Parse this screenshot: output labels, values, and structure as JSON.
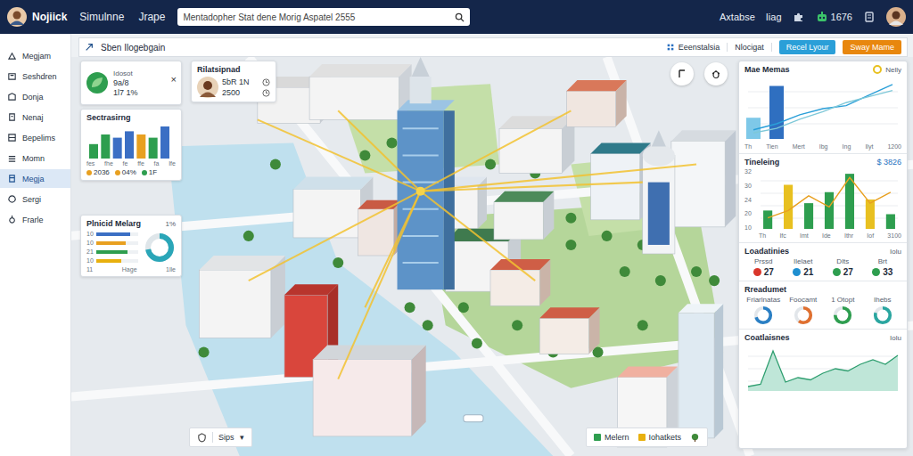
{
  "app": {
    "name": "Nojiick"
  },
  "nav": [
    {
      "label": "Simulnne",
      "selected": false
    },
    {
      "label": "Jrape",
      "selected": false
    }
  ],
  "search": {
    "value": "Mentadopher Stat dene Morig Aspatel 2555"
  },
  "header_links": [
    "Axtabse",
    "Iiag"
  ],
  "header_count": "1676",
  "sidebar": {
    "items": [
      {
        "label": "Megjam",
        "selected": false
      },
      {
        "label": "Seshdren",
        "selected": false
      },
      {
        "label": "Donja",
        "selected": false
      },
      {
        "label": "Nenaj",
        "selected": false
      },
      {
        "label": "Bepelims",
        "selected": false
      },
      {
        "label": "Momn",
        "selected": false
      },
      {
        "label": "Megja",
        "selected": true
      },
      {
        "label": "Sergi",
        "selected": false
      },
      {
        "label": "Frarle",
        "selected": false
      }
    ]
  },
  "toolbar": {
    "title": "Sben Ilogebgain",
    "links": [
      "Eeenstalsia",
      "Nlocigat"
    ],
    "buttons": [
      {
        "label": "Recel Lyour",
        "color": "#2a9fd8"
      },
      {
        "label": "Sway Mame",
        "color": "#e8870e"
      }
    ]
  },
  "status_card": {
    "title": "Idosot",
    "lines": [
      "9a/8",
      "1l7 1%"
    ],
    "close": "×"
  },
  "person_card": {
    "title": "Rilatsipnad",
    "lines": [
      "5bR 1N",
      "2500"
    ]
  },
  "bars_card": {
    "title": "Sectrasirng",
    "values": [
      18,
      30,
      26,
      34,
      30,
      26,
      40
    ],
    "colors": [
      "#2e9e4f",
      "#2e9e4f",
      "#3b6fc4",
      "#3b6fc4",
      "#e8a020",
      "#2e9e4f",
      "#3b6fc4"
    ],
    "axis": [
      "fes",
      "fhe",
      "fe",
      "ffe",
      "fa",
      "Ife"
    ],
    "stats": [
      {
        "value": "2036",
        "color": "#e8a020"
      },
      {
        "value": "04%",
        "color": "#e8a020"
      },
      {
        "value": "1F",
        "color": "#2e9e4f"
      }
    ]
  },
  "mix_card": {
    "title": "Plnicid Melarg",
    "badge": "1%",
    "rows": [
      {
        "label": "10",
        "level": 0.8,
        "color": "#3b6fc4"
      },
      {
        "label": "10",
        "level": 0.7,
        "color": "#e8a020"
      },
      {
        "label": "21",
        "level": 0.75,
        "color": "#2e9e4f"
      },
      {
        "label": "10",
        "level": 0.6,
        "color": "#e8b00e"
      }
    ],
    "donut": {
      "level": 0.72,
      "color": "#2aa6b8"
    },
    "footer": [
      "11",
      "Hage",
      "1lle"
    ]
  },
  "map": {
    "control": {
      "label": "Sips",
      "caret": "▾"
    },
    "legend": [
      {
        "label": "Melern",
        "color": "#2e9e4f"
      },
      {
        "label": "Iohatkets",
        "color": "#e8b00e"
      }
    ]
  },
  "kpi_chart": {
    "title": "Mae Memas",
    "legend": {
      "label": "Nelly",
      "color": "#e8c020"
    },
    "bars": [
      28,
      70,
      0,
      0,
      0,
      0,
      0
    ],
    "bar_colors": [
      "#7ec8e8",
      "#2f6fc0",
      "#2f6fc0",
      "#2f6fc0",
      "#2f6fc0",
      "#2f6fc0",
      "#2f6fc0"
    ],
    "lines": [
      {
        "color": "#2a9fd8",
        "values": [
          12,
          20,
          32,
          40,
          44,
          58,
          72
        ]
      },
      {
        "color": "#7ec8d8",
        "values": [
          8,
          14,
          26,
          36,
          48,
          56,
          64
        ]
      }
    ],
    "x": [
      "Th",
      "Tien",
      "Mert",
      "Ibg",
      "Ing",
      "Ilyt",
      "1200"
    ]
  },
  "trend_chart": {
    "title": "Tineleing",
    "value": "$ 3826",
    "ticks": [
      "32",
      "30",
      "24",
      "20",
      "10"
    ],
    "bars": [
      {
        "value": 10,
        "color": "#2e9e4f"
      },
      {
        "value": 24,
        "color": "#e8c020"
      },
      {
        "value": 14,
        "color": "#2e9e4f"
      },
      {
        "value": 20,
        "color": "#2e9e4f"
      },
      {
        "value": 30,
        "color": "#2e9e4f"
      },
      {
        "value": 16,
        "color": "#e8c020"
      },
      {
        "value": 8,
        "color": "#2e9e4f"
      }
    ],
    "line": {
      "color": "#e8a020",
      "values": [
        6,
        10,
        18,
        12,
        28,
        14,
        20
      ]
    },
    "x": [
      "Th",
      "Ifc",
      "Imt",
      "Ide",
      "Ithr",
      "Iof",
      "3100"
    ]
  },
  "loads": {
    "title": "Loadatinies",
    "meta": "Iolu",
    "items": [
      {
        "label": "Prssd",
        "value": "27",
        "color": "#d9362b"
      },
      {
        "label": "Ilelaet",
        "value": "21",
        "color": "#1f8fd0"
      },
      {
        "label": "Dlts",
        "value": "27",
        "color": "#2e9e4f"
      },
      {
        "label": "Brt",
        "value": "33",
        "color": "#2e9e4f"
      }
    ]
  },
  "readouts": {
    "title": "Rreadumet",
    "items": [
      {
        "label": "Friarlnatas",
        "level": 0.7,
        "color": "#2a7fc4"
      },
      {
        "label": "Foocamt",
        "level": 0.6,
        "color": "#e07030"
      },
      {
        "label": "1 Otopt",
        "level": 0.75,
        "color": "#2e9e4f"
      },
      {
        "label": "Ihebs",
        "level": 0.8,
        "color": "#2aa6a0"
      }
    ]
  },
  "area_chart": {
    "title": "Coatlaisnes",
    "meta": "Iolu",
    "values": [
      2,
      3,
      18,
      4,
      6,
      5,
      8,
      10,
      9,
      12,
      14,
      12,
      16
    ]
  }
}
